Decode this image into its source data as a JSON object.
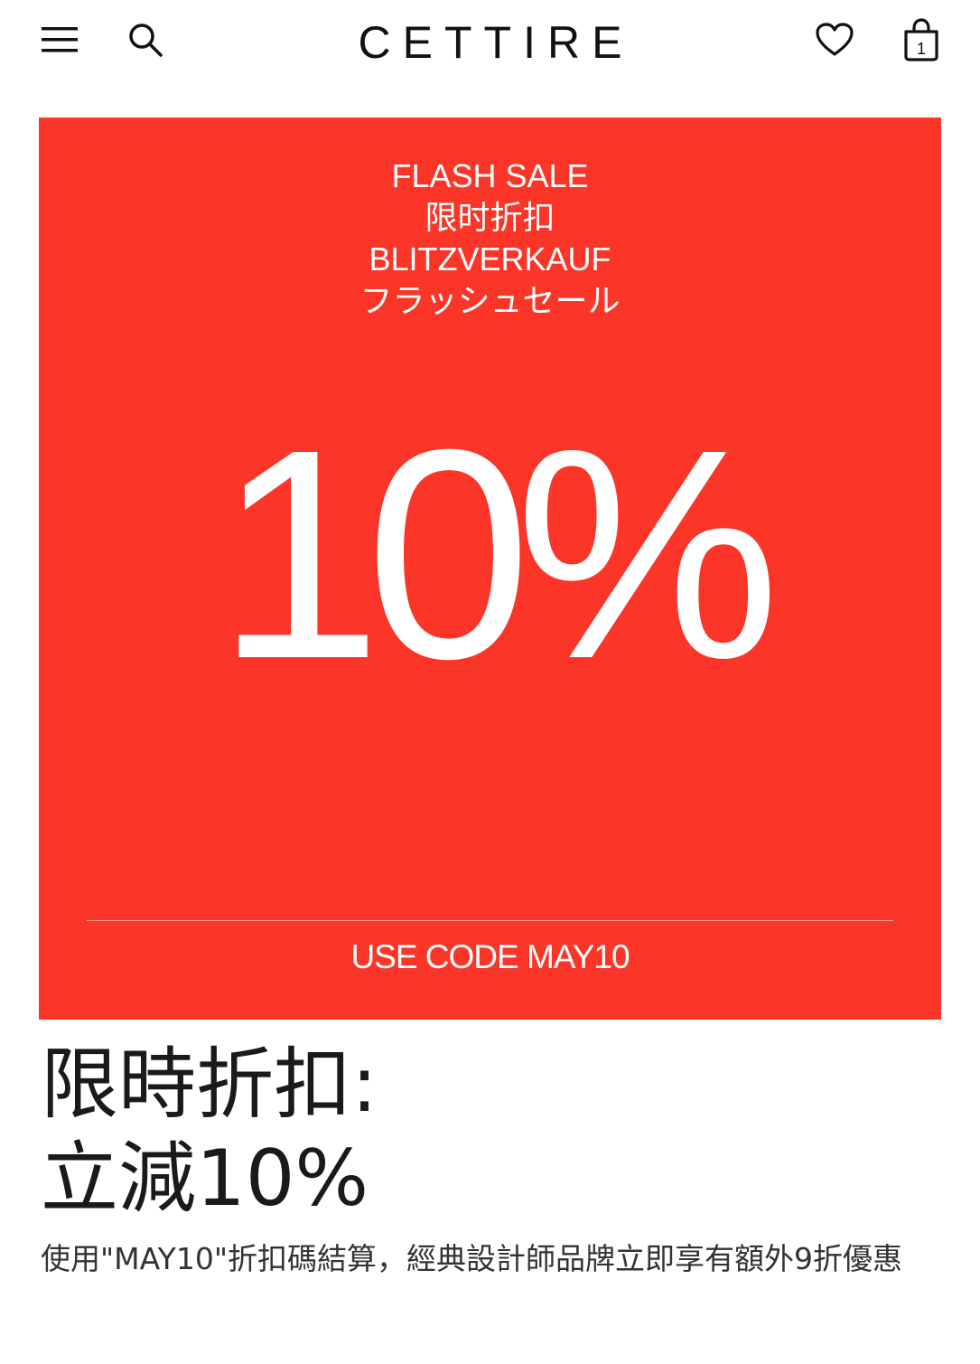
{
  "header": {
    "logo": "CETTIRE",
    "icons": {
      "menu": "hamburger-menu-icon",
      "search": "search-icon",
      "wishlist": "heart-icon",
      "bag": "shopping-bag-icon"
    },
    "bag_count": "1"
  },
  "banner": {
    "background_color": "#fb3628",
    "lines": [
      "FLASH SALE",
      "限时折扣",
      "BLITZVERKAUF",
      "フラッシュセール"
    ],
    "discount": "10%",
    "code_text": "USE CODE MAY10"
  },
  "promo": {
    "title_line1": "限時折扣:",
    "title_line2": "立減10%",
    "description": "使用\"MAY10\"折扣碼結算，經典設計師品牌立即享有額外9折優惠"
  }
}
